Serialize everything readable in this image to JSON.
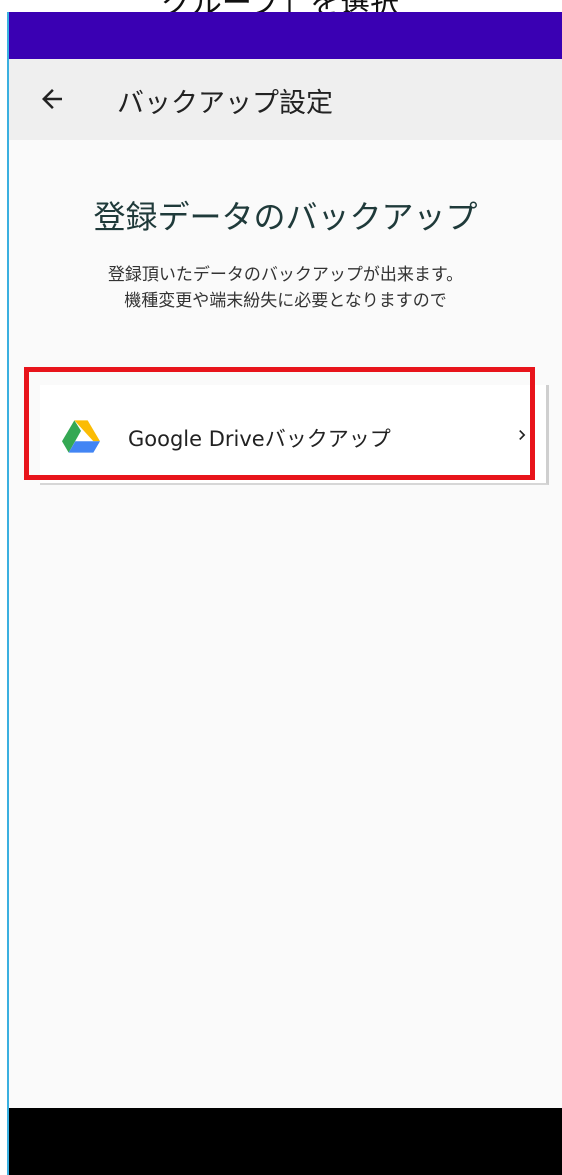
{
  "caption": "グループ」を選択",
  "app_bar": {
    "title": "バックアップ設定",
    "back_icon": "arrow-left-icon"
  },
  "main": {
    "heading": "登録データのバックアップ",
    "description": [
      "登録頂いたデータのバックアップが出来ます。",
      "機種変更や端末紛失に必要となりますので"
    ]
  },
  "backup_options": [
    {
      "label": "Google Driveバックアップ",
      "icon": "google-drive-icon",
      "trailing_icon": "chevron-right-icon"
    }
  ],
  "colors": {
    "status_bar": "#3a00b3",
    "app_bar": "#efefef",
    "highlight": "#e8141b",
    "drive_yellow": "#fbbc04",
    "drive_green": "#34a853",
    "drive_blue": "#4285f4"
  }
}
